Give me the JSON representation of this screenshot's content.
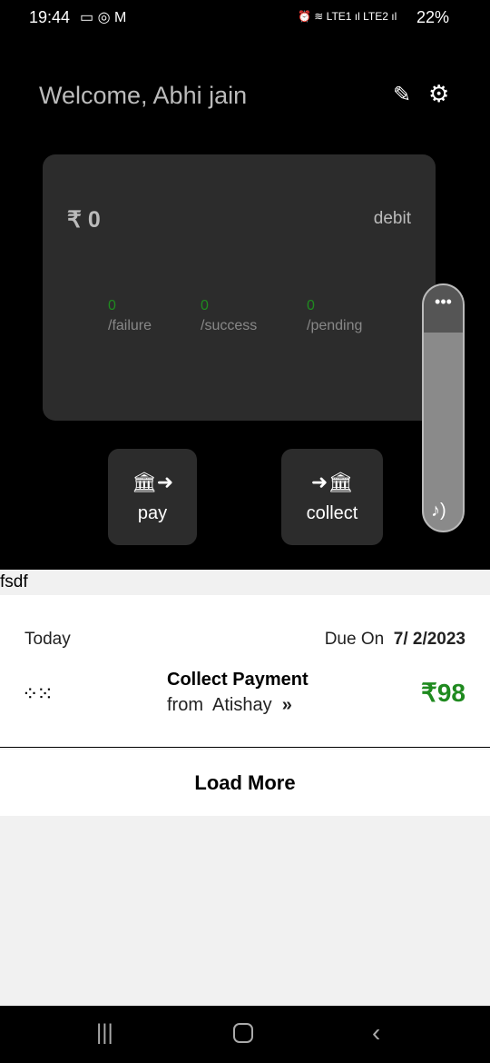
{
  "status": {
    "time": "19:44",
    "battery": "22%",
    "sim1": "LTE1",
    "sim2": "LTE2"
  },
  "header": {
    "welcome": "Welcome, Abhi jain"
  },
  "card": {
    "amount": "₹ 0",
    "type": "debit",
    "stats": [
      {
        "count": "0",
        "label": "/failure"
      },
      {
        "count": "0",
        "label": "/success"
      },
      {
        "count": "0",
        "label": "/pending"
      }
    ]
  },
  "actions": {
    "pay": "pay",
    "collect": "collect"
  },
  "section_label": "fsdf",
  "item": {
    "day": "Today",
    "due_label": "Due On",
    "due_date": "7/ 2/2023",
    "title": "Collect Payment",
    "from": "from  Atishay",
    "amount": "₹98"
  },
  "load_more": "Load More",
  "colors": {
    "accent": "#1f8a1f"
  }
}
